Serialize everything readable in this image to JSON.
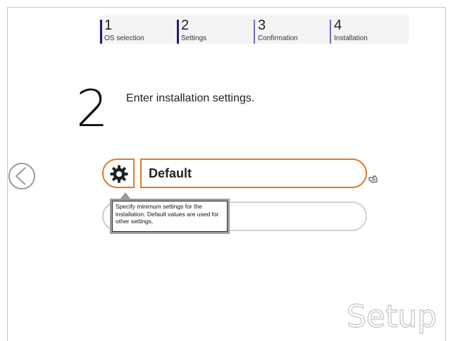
{
  "steps": [
    {
      "num": "1",
      "label": "OS selection"
    },
    {
      "num": "2",
      "label": "Settings"
    },
    {
      "num": "3",
      "label": "Confirmation"
    },
    {
      "num": "4",
      "label": "Installation"
    }
  ],
  "page": {
    "current_step": "2",
    "heading": "Enter installation settings."
  },
  "options": {
    "selected_label": "Default",
    "tooltip": "Specify minimum settings for the installation. Default values are used for other settings."
  },
  "icons": {
    "back": "left-arrow-icon",
    "gear": "gear-icon",
    "cursor": "hand-cursor-icon"
  },
  "colors": {
    "accent": "#e07a2a",
    "step_bar": "#1c1e6e"
  },
  "brand": "Setup"
}
